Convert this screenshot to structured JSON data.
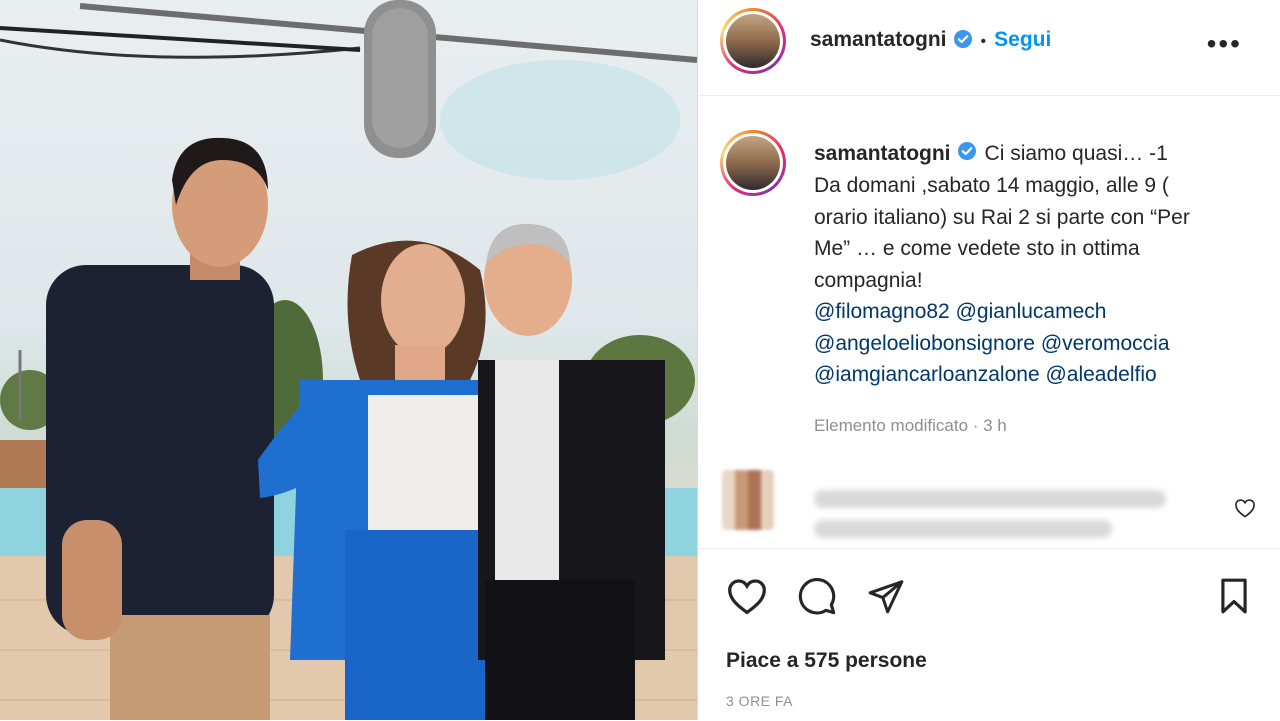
{
  "post": {
    "username": "samantatogni",
    "follow_label": "Segui",
    "more_label": "•••",
    "caption_lines": [
      "Ci siamo quasi… -1",
      "Da domani ,sabato 14 maggio, alle 9 (",
      "orario italiano) su Rai 2 si parte con “Per",
      "Me” … e come vedete sto in ottima",
      "compagnia!"
    ],
    "mentions": [
      "@filomagno82 @gianlucamech",
      "@angeloeliobonsignore @veromoccia",
      "@iamgiancarloanzalone @aleadelfio"
    ],
    "edited_label": "Elemento modificato · 3 h",
    "likes_label": "Piace a 575 persone",
    "time_label": "3 ORE FA"
  },
  "icons": {
    "verified": "verified-badge-icon",
    "more": "more-options-icon",
    "like": "heart-icon",
    "comment": "comment-icon",
    "share": "share-icon",
    "save": "bookmark-icon",
    "comment_like": "heart-icon"
  },
  "colors": {
    "accent": "#0095f6",
    "verified": "#3897f0",
    "mention": "#00376b",
    "muted": "#8e8e8e",
    "text": "#262626"
  }
}
